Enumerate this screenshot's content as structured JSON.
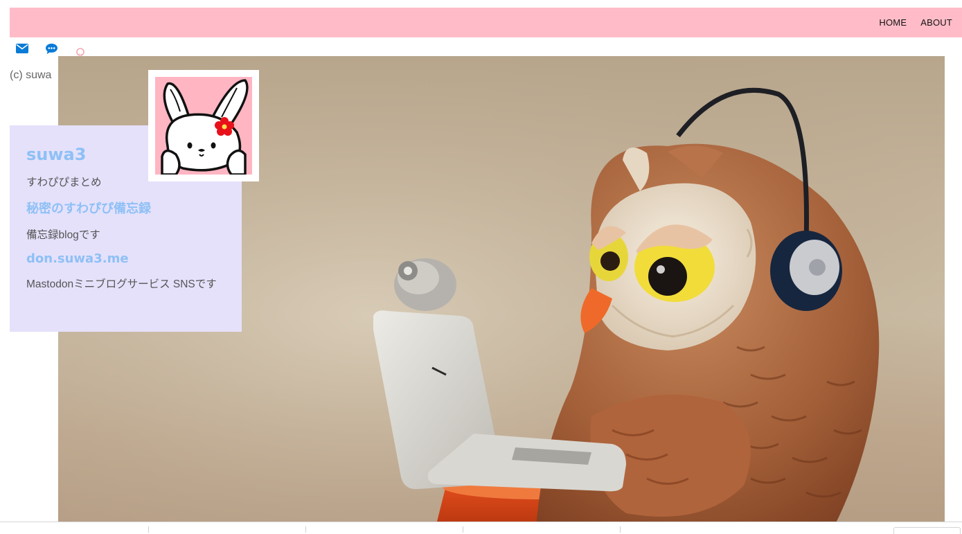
{
  "nav": {
    "items": [
      {
        "label": "HOME"
      },
      {
        "label": "ABOUT"
      }
    ]
  },
  "social": {
    "icons": [
      "envelope-icon",
      "chat-bubble-icon",
      "github-icon"
    ]
  },
  "footer": {
    "copyright": "(c) suwa"
  },
  "profile": {
    "title": "suwa3",
    "subtitle": "すわぴぴまとめ",
    "links": [
      {
        "label": "秘密のすわぴぴ備忘録",
        "desc": "備忘録blogです"
      },
      {
        "label": "don.suwa3.me",
        "desc": "Mastodonミニブログサービス SNSです"
      }
    ]
  },
  "colors": {
    "topbar": "#ffbcc8",
    "card": "#e5e1fb",
    "accent_link": "#8ec0f6",
    "icon_blue": "#0a7bd7"
  }
}
